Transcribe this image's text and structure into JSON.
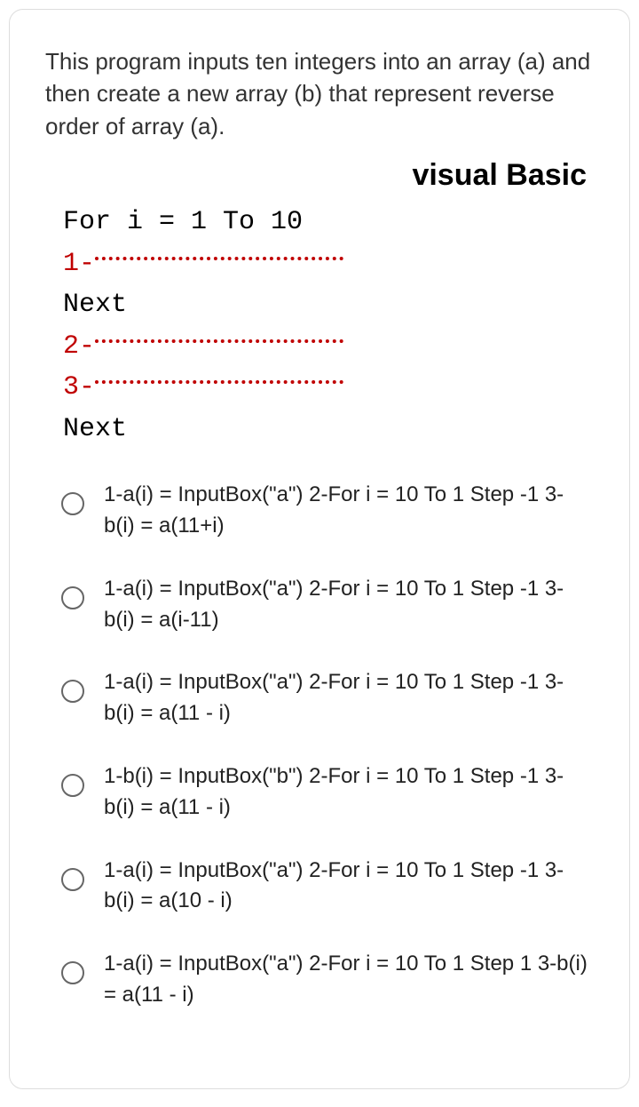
{
  "question": "This program inputs ten integers into an array (a) and then create a new array (b) that represent reverse order of array (a).",
  "language": "visual Basic",
  "code": {
    "line1": "For i = 1 To 10",
    "blank1": "1-",
    "line2": "Next",
    "blank2": "2-",
    "blank3": "3-",
    "line3": "Next"
  },
  "options": [
    "1-a(i) = InputBox(\"a\") 2-For i = 10 To 1 Step -1 3-b(i) = a(11+i)",
    "1-a(i) = InputBox(\"a\") 2-For i = 10 To 1 Step -1 3-b(i) = a(i-11)",
    "1-a(i) = InputBox(\"a\") 2-For i = 10 To 1 Step -1 3-b(i) = a(11 - i)",
    "1-b(i) = InputBox(\"b\") 2-For i = 10 To 1 Step -1 3-b(i) = a(11 - i)",
    "1-a(i) = InputBox(\"a\") 2-For i = 10 To 1 Step -1 3-b(i) = a(10 - i)",
    "1-a(i) = InputBox(\"a\") 2-For i = 10 To 1 Step 1 3-b(i) = a(11 - i)"
  ]
}
